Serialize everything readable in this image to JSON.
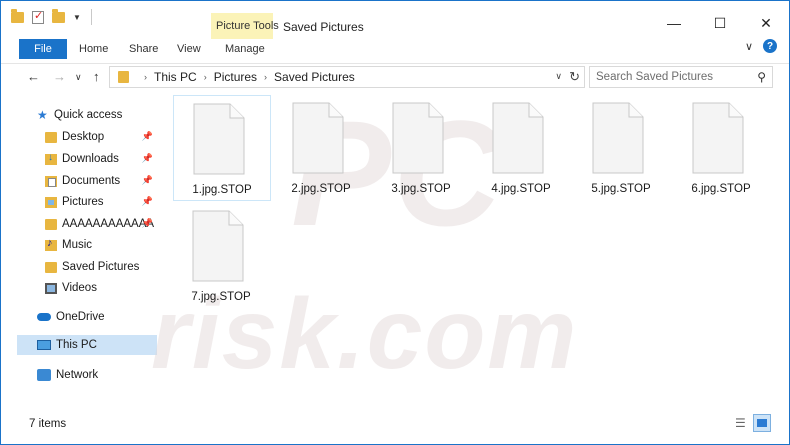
{
  "window": {
    "title": "Saved Pictures",
    "context_tab_group": "Picture Tools",
    "controls": {
      "minimize": "—",
      "maximize": "☐",
      "close": "✕"
    }
  },
  "ribbon": {
    "tabs": [
      "File",
      "Home",
      "Share",
      "View",
      "Manage"
    ],
    "expand_icon": "chevron-down-icon",
    "help_label": "?"
  },
  "address": {
    "crumbs": [
      "This PC",
      "Pictures",
      "Saved Pictures"
    ],
    "search_placeholder": "Search Saved Pictures"
  },
  "nav": {
    "quick_access": "Quick access",
    "items": [
      {
        "label": "Desktop",
        "icon": "folder-icon",
        "pinned": true
      },
      {
        "label": "Downloads",
        "icon": "downloads-icon",
        "pinned": true
      },
      {
        "label": "Documents",
        "icon": "documents-icon",
        "pinned": true
      },
      {
        "label": "Pictures",
        "icon": "pictures-icon",
        "pinned": true
      },
      {
        "label": "AAAAAAAAAAAA",
        "icon": "folder-icon",
        "pinned": true
      },
      {
        "label": "Music",
        "icon": "music-icon",
        "pinned": false
      },
      {
        "label": "Saved Pictures",
        "icon": "folder-icon",
        "pinned": false
      },
      {
        "label": "Videos",
        "icon": "videos-icon",
        "pinned": false
      }
    ],
    "onedrive": "OneDrive",
    "this_pc": "This PC",
    "network": "Network"
  },
  "files": [
    "1.jpg.STOP",
    "2.jpg.STOP",
    "3.jpg.STOP",
    "4.jpg.STOP",
    "5.jpg.STOP",
    "6.jpg.STOP",
    "7.jpg.STOP"
  ],
  "status": {
    "item_count": "7 items"
  },
  "watermark": {
    "logo_text": "PC",
    "site_text": "risk.com"
  },
  "colors": {
    "accent": "#1a73c9",
    "context_tab": "#fbf3b8",
    "selection": "#cde3f7"
  }
}
